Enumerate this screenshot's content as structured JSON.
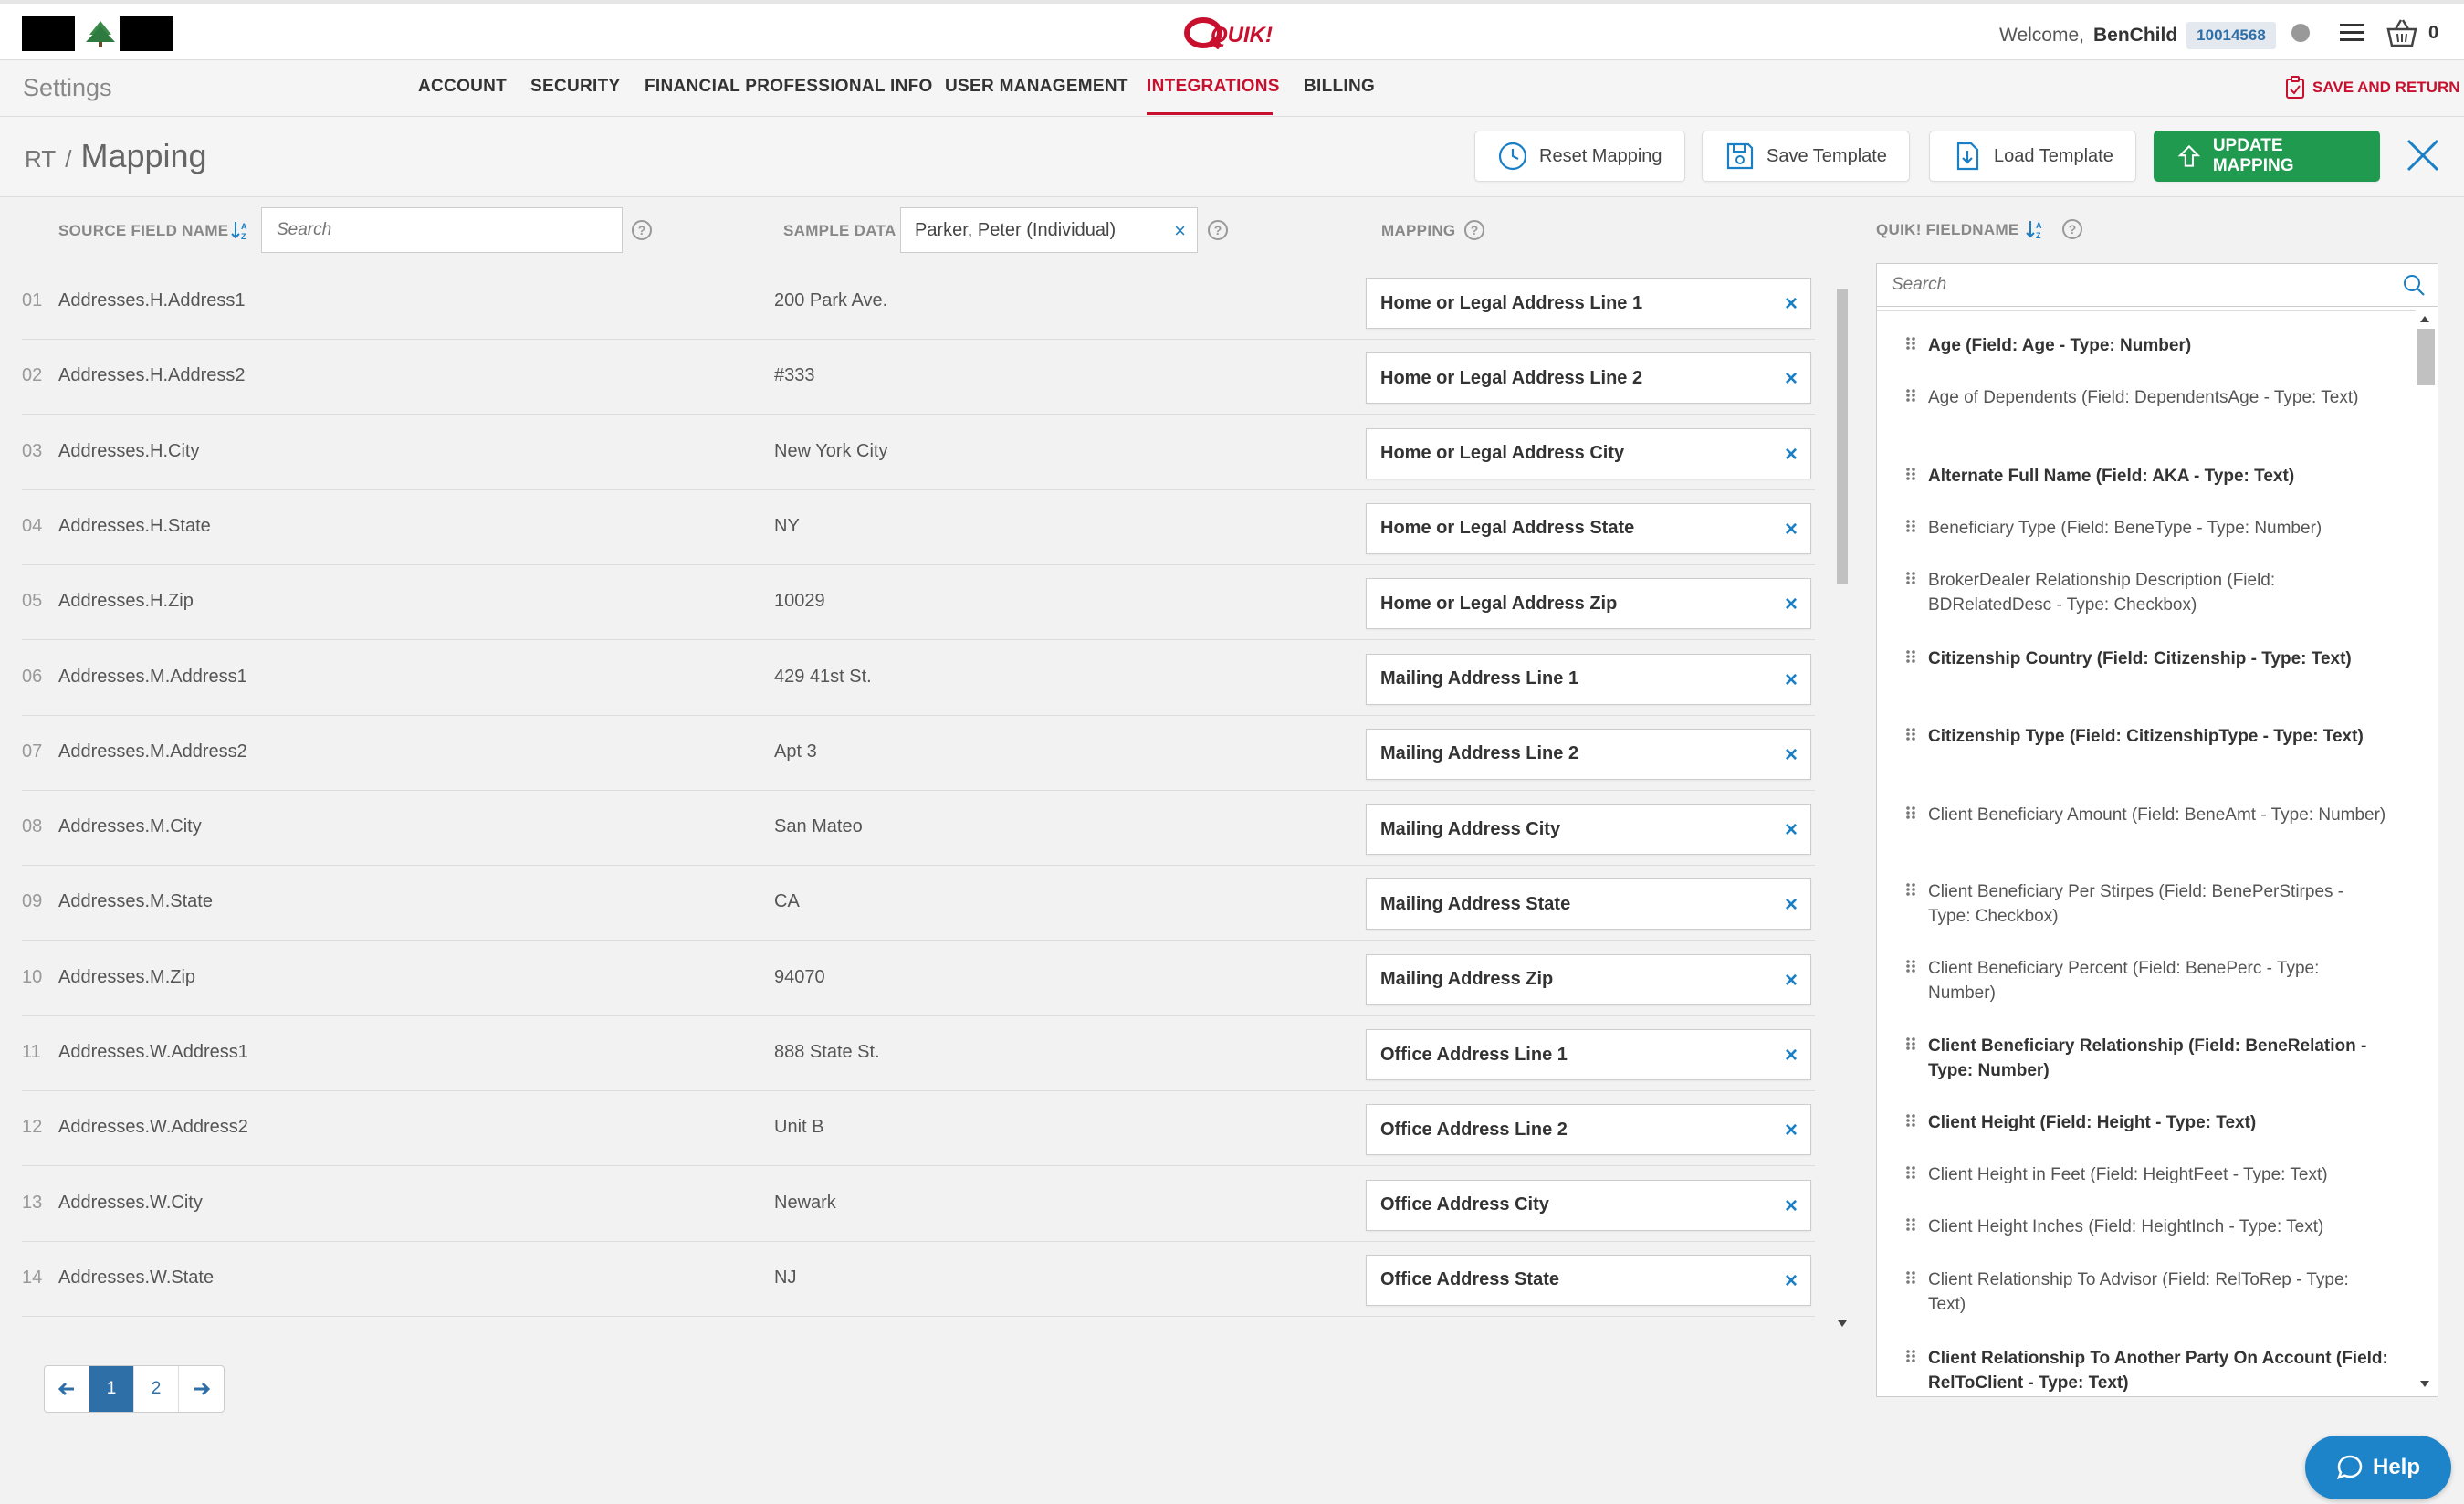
{
  "topbar": {
    "brand": "QUIK!",
    "welcome_label": "Welcome,",
    "user_name": "BenChild",
    "account_id": "10014568",
    "cart_count": "0"
  },
  "settings_nav": {
    "title": "Settings",
    "tabs": [
      {
        "label": "ACCOUNT"
      },
      {
        "label": "SECURITY"
      },
      {
        "label": "FINANCIAL PROFESSIONAL INFO"
      },
      {
        "label": "USER MANAGEMENT"
      },
      {
        "label": "INTEGRATIONS",
        "active": true
      },
      {
        "label": "BILLING"
      }
    ],
    "save_return": "SAVE AND RETURN"
  },
  "page": {
    "prefix": "RT",
    "separator": "/",
    "title": "Mapping",
    "buttons": {
      "reset": "Reset Mapping",
      "save_template": "Save Template",
      "load_template": "Load Template",
      "update": "UPDATE MAPPING"
    }
  },
  "columns": {
    "source": "SOURCE FIELD NAME",
    "sample": "SAMPLE DATA",
    "mapping": "MAPPING",
    "quik_field": "QUIK! FIELDNAME",
    "search_placeholder": "Search",
    "sample_selected": "Parker, Peter (Individual)"
  },
  "rows": [
    {
      "num": "01",
      "source": "Addresses.H.Address1",
      "sample": "200 Park Ave.",
      "mapping": "Home or Legal Address Line 1"
    },
    {
      "num": "02",
      "source": "Addresses.H.Address2",
      "sample": "#333",
      "mapping": "Home or Legal Address Line 2"
    },
    {
      "num": "03",
      "source": "Addresses.H.City",
      "sample": "New York City",
      "mapping": "Home or Legal Address City"
    },
    {
      "num": "04",
      "source": "Addresses.H.State",
      "sample": "NY",
      "mapping": "Home or Legal Address State"
    },
    {
      "num": "05",
      "source": "Addresses.H.Zip",
      "sample": "10029",
      "mapping": "Home or Legal Address Zip"
    },
    {
      "num": "06",
      "source": "Addresses.M.Address1",
      "sample": "429 41st St.",
      "mapping": "Mailing Address Line 1"
    },
    {
      "num": "07",
      "source": "Addresses.M.Address2",
      "sample": "Apt 3",
      "mapping": "Mailing Address Line 2"
    },
    {
      "num": "08",
      "source": "Addresses.M.City",
      "sample": "San Mateo",
      "mapping": "Mailing Address City"
    },
    {
      "num": "09",
      "source": "Addresses.M.State",
      "sample": "CA",
      "mapping": "Mailing Address State"
    },
    {
      "num": "10",
      "source": "Addresses.M.Zip",
      "sample": "94070",
      "mapping": "Mailing Address Zip"
    },
    {
      "num": "11",
      "source": "Addresses.W.Address1",
      "sample": "888 State St.",
      "mapping": "Office Address Line 1"
    },
    {
      "num": "12",
      "source": "Addresses.W.Address2",
      "sample": "Unit B",
      "mapping": "Office Address Line 2"
    },
    {
      "num": "13",
      "source": "Addresses.W.City",
      "sample": "Newark",
      "mapping": "Office Address City"
    },
    {
      "num": "14",
      "source": "Addresses.W.State",
      "sample": "NJ",
      "mapping": "Office Address State"
    },
    {
      "num": "",
      "source": "",
      "sample": "",
      "mapping": ""
    }
  ],
  "pagination": {
    "pages": [
      "1",
      "2"
    ],
    "current": "1"
  },
  "quik_fields": [
    {
      "text": "Age (Field: Age - Type: Number)",
      "bold": true
    },
    {
      "text": "Age of Dependents (Field: DependentsAge - Type: Text)",
      "bold": false
    },
    {
      "text": "Alternate Full Name (Field: AKA - Type: Text)",
      "bold": true
    },
    {
      "text": "Beneficiary Type (Field: BeneType - Type: Number)",
      "bold": false
    },
    {
      "text": "BrokerDealer Relationship Description (Field: BDRelatedDesc - Type: Checkbox)",
      "bold": false
    },
    {
      "text": "Citizenship Country (Field: Citizenship - Type: Text)",
      "bold": true
    },
    {
      "text": "Citizenship Type (Field: CitizenshipType - Type: Text)",
      "bold": true
    },
    {
      "text": "Client Beneficiary Amount (Field: BeneAmt - Type: Number)",
      "bold": false
    },
    {
      "text": "Client Beneficiary Per Stirpes (Field: BenePerStirpes - Type: Checkbox)",
      "bold": false
    },
    {
      "text": "Client Beneficiary Percent (Field: BenePerc - Type: Number)",
      "bold": false
    },
    {
      "text": "Client Beneficiary Relationship (Field: BeneRelation - Type: Number)",
      "bold": true
    },
    {
      "text": "Client Height (Field: Height - Type: Text)",
      "bold": true
    },
    {
      "text": "Client Height in Feet (Field: HeightFeet - Type: Text)",
      "bold": false
    },
    {
      "text": "Client Height Inches (Field: HeightInch - Type: Text)",
      "bold": false
    },
    {
      "text": "Client Relationship To Advisor (Field: RelToRep - Type: Text)",
      "bold": false
    },
    {
      "text": "Client Relationship To Another Party On Account (Field: RelToClient - Type: Text)",
      "bold": true
    }
  ],
  "help_label": "Help",
  "colors": {
    "accent_red": "#c8102e",
    "primary_green": "#1f9a4f",
    "link_blue": "#1a7fc4",
    "help_blue": "#1e84c9"
  }
}
